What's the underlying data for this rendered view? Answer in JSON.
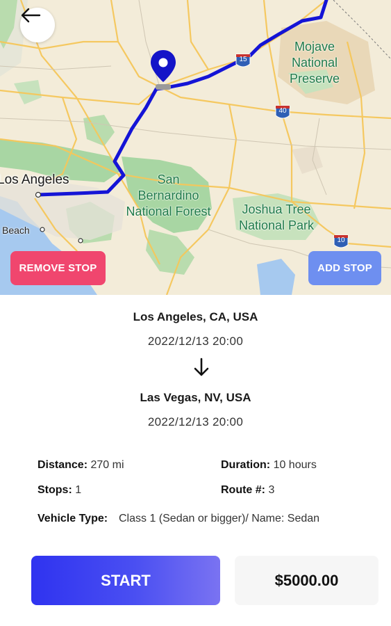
{
  "map": {
    "labels": {
      "los_angeles": "Los Angeles",
      "san_bernardino": "San Bernardino National Forest",
      "san": "San",
      "bernardino": "Bernardino",
      "national_forest": "National Forest",
      "mojave_1": "Mojave",
      "mojave_2": "National",
      "mojave_3": "Preserve",
      "joshua_1": "Joshua Tree",
      "joshua_2": "National Park",
      "beach": "Beach",
      "i15": "15",
      "i40": "40",
      "i10": "10"
    },
    "colors": {
      "route": "#1414d6",
      "pin": "#1414c8",
      "land": "#f3ecd9",
      "park": "#a8d6a3",
      "water": "#a6c9ef"
    }
  },
  "buttons": {
    "back_icon": "arrow-left-icon",
    "remove_stop": "REMOVE STOP",
    "add_stop": "ADD STOP",
    "start": "START"
  },
  "route": {
    "origin": "Los Angeles, CA, USA",
    "origin_time": "2022/12/13 20:00",
    "destination": "Las Vegas, NV, USA",
    "destination_time": "2022/12/13 20:00"
  },
  "details": {
    "distance_label": "Distance:",
    "distance_value": "270 mi",
    "duration_label": "Duration:",
    "duration_value": "10 hours",
    "stops_label": "Stops:",
    "stops_value": "1",
    "route_label": "Route #:",
    "route_value": "3",
    "vehicle_label": "Vehicle Type:",
    "vehicle_value": "Class 1 (Sedan or bigger)/ Name: Sedan"
  },
  "price": "$5000.00"
}
